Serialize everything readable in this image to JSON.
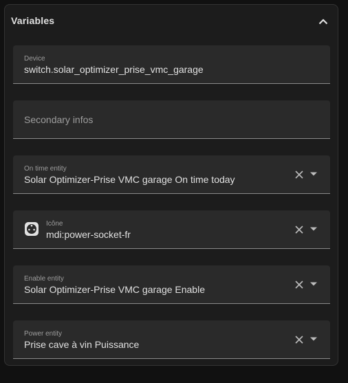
{
  "panel": {
    "title": "Variables"
  },
  "fields": {
    "device": {
      "label": "Device",
      "value": "switch.solar_optimizer_prise_vmc_garage"
    },
    "secondary_infos": {
      "placeholder": "Secondary infos"
    },
    "on_time_entity": {
      "label": "On time entity",
      "value": "Solar Optimizer-Prise VMC garage On time today"
    },
    "icon": {
      "label": "Icône",
      "value": "mdi:power-socket-fr",
      "icon_name": "power-socket-fr-icon"
    },
    "enable_entity": {
      "label": "Enable entity",
      "value": "Solar Optimizer-Prise VMC garage Enable"
    },
    "power_entity": {
      "label": "Power entity",
      "value": "Prise cave à vin Puissance"
    }
  },
  "colors": {
    "background": "#111111",
    "panel": "#1c1c1c",
    "field": "#2a2a2a",
    "text": "#e1e1e1",
    "muted": "#9e9e9e"
  }
}
